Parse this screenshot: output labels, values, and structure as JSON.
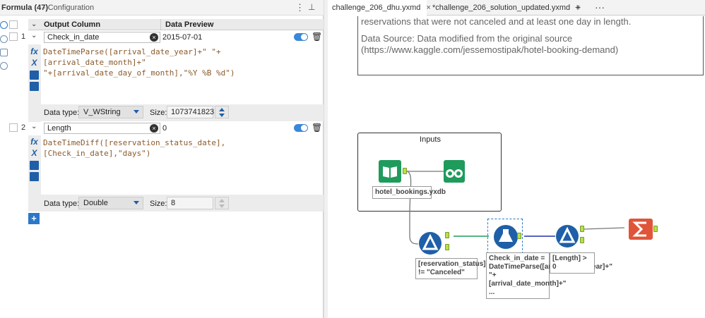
{
  "config": {
    "title": "Formula (47)",
    "subtitle": "- Configuration",
    "col_output": "Output Column",
    "col_preview": "Data Preview",
    "add_label": "+"
  },
  "formulas": [
    {
      "num": "1",
      "name": "Check_in_date",
      "preview": "2015-07-01",
      "expr_line1": "DateTimeParse([arrival_date_year]+\" \"+[arrival_date_month]+\"",
      "expr_line2": "\"+[arrival_date_day_of_month],\"%Y %B %d\")",
      "type_label": "Data type:",
      "type": "V_WString",
      "size_label": "Size:",
      "size": "1073741823"
    },
    {
      "num": "2",
      "name": "Length",
      "preview": "0",
      "expr_line1": "DateTimeDiff([reservation_status_date],[Check_in_date],\"days\")",
      "type_label": "Data type:",
      "type": "Double",
      "size_label": "Size:",
      "size": "8"
    }
  ],
  "tabs": [
    {
      "label": "challenge_206_dhu.yxmd",
      "active": true
    },
    {
      "label": "*challenge_206_solution_updated.yxmd",
      "active": false
    }
  ],
  "canvas": {
    "comment_line1": "reservations that were not canceled and at least one day in length.",
    "comment_line2": "Data Source: Data modified from the original source",
    "comment_line3": "(https://www.kaggle.com/jessemostipak/hotel-booking-demand)",
    "container_title": "Inputs",
    "input_anno": "hotel_bookings.yxdb",
    "filter1_anno": "[reservation_status] != \"Canceled\"",
    "formula_anno": "Check_in_date = DateTimeParse([arrival_date_year]+\" \"+[arrival_date_month]+\"  ...",
    "filter2_anno": "[Length] > 0"
  },
  "colors": {
    "accent": "#2b78c9",
    "filter_tool": "#1f5fa8",
    "input_tool": "#1f9b5b",
    "summarize_tool": "#e0553a",
    "anchor": "#b6e04b"
  }
}
